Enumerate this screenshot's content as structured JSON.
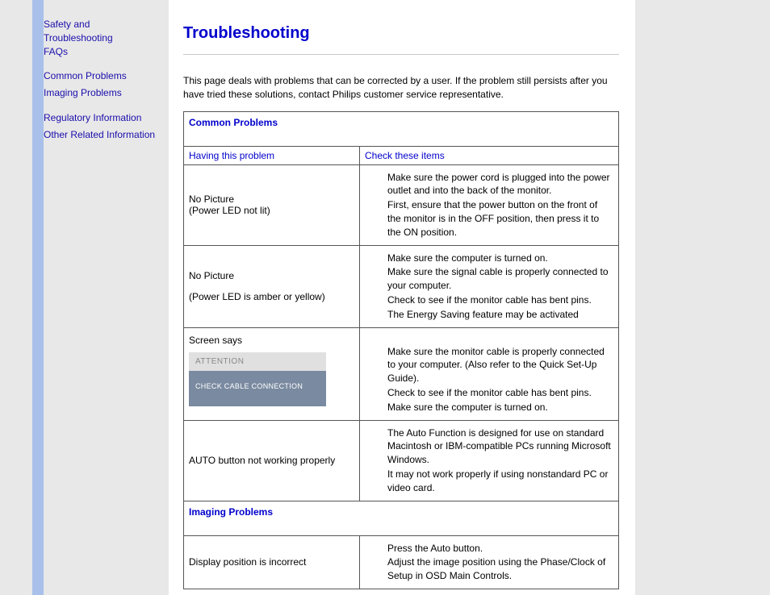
{
  "sidebar": {
    "group1": {
      "line1": "Safety and",
      "line2": "Troubleshooting",
      "line3": "FAQs"
    },
    "link_common": "Common Problems",
    "link_imaging": "Imaging Problems",
    "link_regulatory": "Regulatory Information",
    "link_other": "Other Related Information"
  },
  "main": {
    "title": "Troubleshooting",
    "intro": "This page deals with problems that can be corrected by a user. If the problem still persists after you have tried these solutions, contact Philips customer service representative."
  },
  "table": {
    "section_common": "Common Problems",
    "col_problem": "Having this problem",
    "col_check": "Check these items",
    "rows": [
      {
        "problem_l1": "No Picture",
        "problem_l2": "(Power LED not lit)",
        "checks": [
          "Make sure the power cord is plugged into the power outlet and into the back of the monitor.",
          "First, ensure that the power button on the front of the monitor is in the OFF position, then press it to the ON position."
        ]
      },
      {
        "problem_l1": "No Picture",
        "problem_l2": "(Power LED is amber or yellow)",
        "checks": [
          "Make sure the computer is turned on.",
          "Make sure the signal cable is properly connected to your computer.",
          "Check to see if the monitor cable has bent pins.",
          "The Energy Saving feature may be activated"
        ]
      },
      {
        "problem_l1": "Screen says",
        "osd_title": "ATTENTION",
        "osd_body": "CHECK CABLE CONNECTION",
        "checks": [
          "Make sure the monitor cable is properly connected to your computer. (Also refer to the Quick Set-Up Guide).",
          "Check to see if the monitor cable has bent pins.",
          "Make sure the computer is turned on."
        ]
      },
      {
        "problem_l1": "AUTO button not working properly",
        "checks": [
          "The Auto Function is designed for use on standard Macintosh or IBM-compatible PCs running Microsoft Windows.",
          "It may not work properly if using nonstandard PC or video card."
        ]
      }
    ],
    "section_imaging": "Imaging Problems",
    "imaging_rows": [
      {
        "problem_l1": "Display position is incorrect",
        "checks": [
          "Press the Auto button.",
          "Adjust the image position using the Phase/Clock of Setup in OSD Main Controls."
        ]
      }
    ]
  }
}
